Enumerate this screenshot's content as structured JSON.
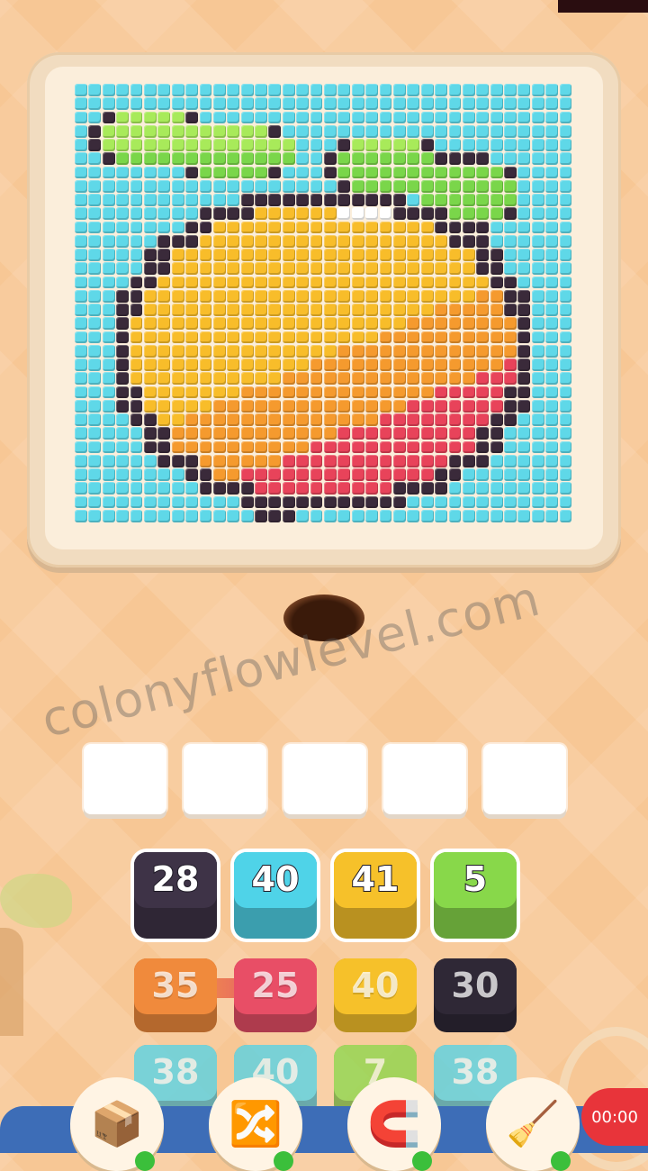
{
  "colors": {
    "background": "#f7c795",
    "sky": "#5fd8e8",
    "outline": "#3a2a3a",
    "white": "#ffffff",
    "leaf_green": "#7ad64a",
    "leaf_light": "#a8ea5a",
    "fruit_yellow": "#f8bd2a",
    "fruit_orange": "#f59a2e",
    "fruit_red": "#e8435a",
    "slot": "#ffffff",
    "block_dark": "#3e3347",
    "block_cyan": "#4fd3e8",
    "block_yellow": "#f6c12a",
    "block_green": "#88d84a",
    "block_orange": "#f08a3c",
    "block_red": "#e84e66",
    "block_dark2": "#2f2836",
    "recorder": "#e8343a"
  },
  "puzzle": {
    "subject": "peach",
    "grid_cols": 36,
    "grid_rows": 32
  },
  "watermark": "colonyflowlevel.com",
  "slots": [
    "",
    "",
    "",
    "",
    ""
  ],
  "blocks": {
    "row1": [
      {
        "value": "28",
        "color": "dark"
      },
      {
        "value": "40",
        "color": "cyan"
      },
      {
        "value": "41",
        "color": "yellow"
      },
      {
        "value": "5",
        "color": "green"
      }
    ],
    "row2": [
      {
        "value": "35",
        "color": "orange"
      },
      {
        "value": "25",
        "color": "red"
      },
      {
        "value": "40",
        "color": "yellow"
      },
      {
        "value": "30",
        "color": "dark"
      }
    ],
    "row3": [
      {
        "value": "38",
        "color": "cyan"
      },
      {
        "value": "40",
        "color": "cyan"
      },
      {
        "value": "7",
        "color": "green"
      },
      {
        "value": "38",
        "color": "cyan"
      }
    ]
  },
  "tools": [
    {
      "name": "add-slot",
      "icon": "box-plus-icon",
      "glyph": "📦"
    },
    {
      "name": "shuffle",
      "icon": "shuffle-icon",
      "glyph": "🔀"
    },
    {
      "name": "magnet",
      "icon": "claw-icon",
      "glyph": "🧲"
    },
    {
      "name": "vacuum",
      "icon": "vacuum-icon",
      "glyph": "🧹"
    }
  ],
  "recorder": {
    "time": "00:00"
  }
}
